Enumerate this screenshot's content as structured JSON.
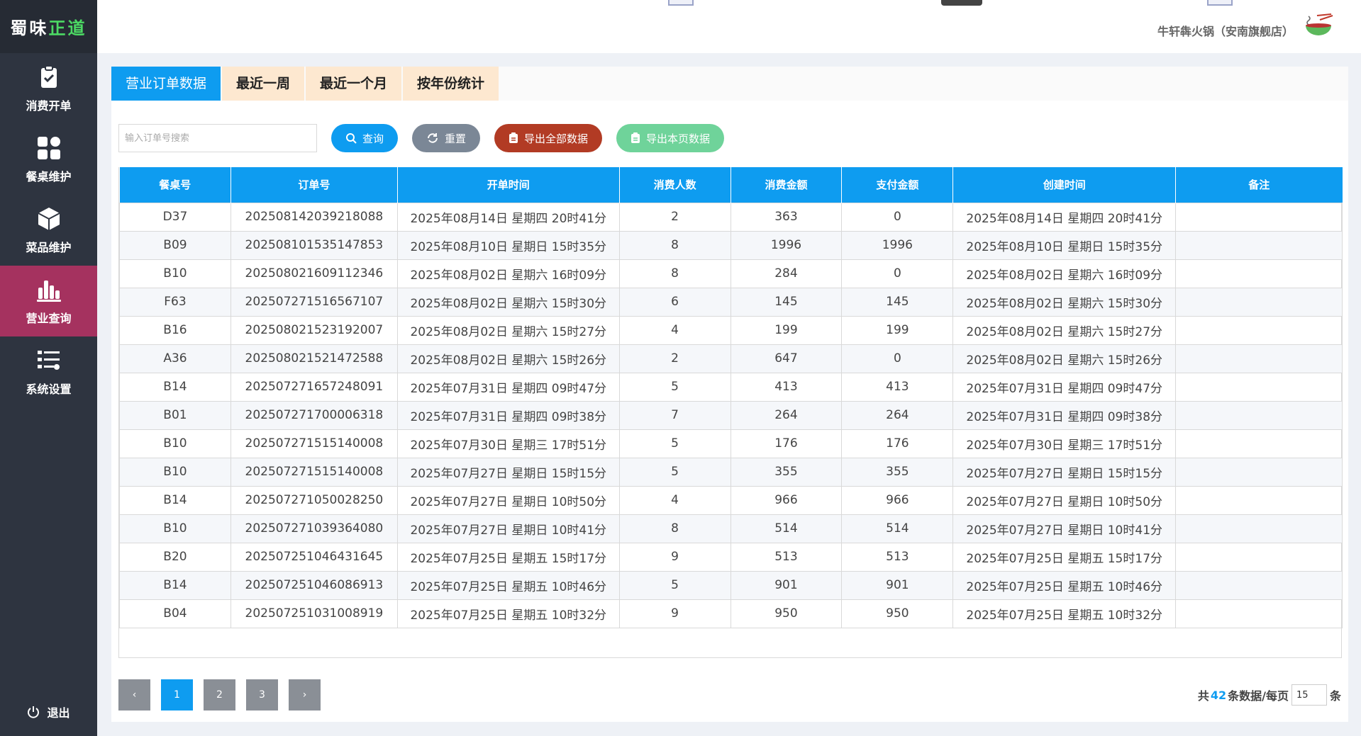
{
  "brand": {
    "part1": "蜀味",
    "part2": "正道"
  },
  "sidebar": {
    "items": [
      {
        "label": "消费开单",
        "icon": "clipboard-check-icon"
      },
      {
        "label": "餐桌维护",
        "icon": "grid-apps-icon"
      },
      {
        "label": "菜品维护",
        "icon": "box-icon"
      },
      {
        "label": "营业查询",
        "icon": "bar-chart-icon",
        "active": true
      },
      {
        "label": "系统设置",
        "icon": "settings-list-icon"
      }
    ],
    "logout_label": "退出"
  },
  "header": {
    "store_name": "牛轩犇火锅（安南旗舰店）"
  },
  "tabs": [
    "营业订单数据",
    "最近一周",
    "最近一个月",
    "按年份统计"
  ],
  "toolbar": {
    "search_placeholder": "输入订单号搜索",
    "query_label": "查询",
    "reset_label": "重置",
    "export_all_label": "导出全部数据",
    "export_page_label": "导出本页数据"
  },
  "table": {
    "headers": [
      "餐桌号",
      "订单号",
      "开单时间",
      "消费人数",
      "消费金额",
      "支付金额",
      "创建时间",
      "备注"
    ],
    "rows": [
      [
        "D37",
        "202508142039218088",
        "2025年08月14日 星期四 20时41分",
        "2",
        "363",
        "0",
        "2025年08月14日 星期四 20时41分",
        ""
      ],
      [
        "B09",
        "202508101535147853",
        "2025年08月10日 星期日 15时35分",
        "8",
        "1996",
        "1996",
        "2025年08月10日 星期日 15时35分",
        ""
      ],
      [
        "B10",
        "202508021609112346",
        "2025年08月02日 星期六 16时09分",
        "8",
        "284",
        "0",
        "2025年08月02日 星期六 16时09分",
        ""
      ],
      [
        "F63",
        "202507271516567107",
        "2025年08月02日 星期六 15时30分",
        "6",
        "145",
        "145",
        "2025年08月02日 星期六 15时30分",
        ""
      ],
      [
        "B16",
        "202508021523192007",
        "2025年08月02日 星期六 15时27分",
        "4",
        "199",
        "199",
        "2025年08月02日 星期六 15时27分",
        ""
      ],
      [
        "A36",
        "202508021521472588",
        "2025年08月02日 星期六 15时26分",
        "2",
        "647",
        "0",
        "2025年08月02日 星期六 15时26分",
        ""
      ],
      [
        "B14",
        "202507271657248091",
        "2025年07月31日 星期四 09时47分",
        "5",
        "413",
        "413",
        "2025年07月31日 星期四 09时47分",
        ""
      ],
      [
        "B01",
        "202507271700006318",
        "2025年07月31日 星期四 09时38分",
        "7",
        "264",
        "264",
        "2025年07月31日 星期四 09时38分",
        ""
      ],
      [
        "B10",
        "202507271515140008",
        "2025年07月30日 星期三 17时51分",
        "5",
        "176",
        "176",
        "2025年07月30日 星期三 17时51分",
        ""
      ],
      [
        "B10",
        "202507271515140008",
        "2025年07月27日 星期日 15时15分",
        "5",
        "355",
        "355",
        "2025年07月27日 星期日 15时15分",
        ""
      ],
      [
        "B14",
        "202507271050028250",
        "2025年07月27日 星期日 10时50分",
        "4",
        "966",
        "966",
        "2025年07月27日 星期日 10时50分",
        ""
      ],
      [
        "B10",
        "202507271039364080",
        "2025年07月27日 星期日 10时41分",
        "8",
        "514",
        "514",
        "2025年07月27日 星期日 10时41分",
        ""
      ],
      [
        "B20",
        "202507251046431645",
        "2025年07月25日 星期五 15时17分",
        "9",
        "513",
        "513",
        "2025年07月25日 星期五 15时17分",
        ""
      ],
      [
        "B14",
        "202507251046086913",
        "2025年07月25日 星期五 10时46分",
        "5",
        "901",
        "901",
        "2025年07月25日 星期五 10时46分",
        ""
      ],
      [
        "B04",
        "202507251031008919",
        "2025年07月25日 星期五 10时32分",
        "9",
        "950",
        "950",
        "2025年07月25日 星期五 10时32分",
        ""
      ]
    ]
  },
  "pagination": {
    "prev": "‹",
    "next": "›",
    "pages": [
      "1",
      "2",
      "3"
    ],
    "current": "1",
    "total_prefix": "共",
    "total_count": "42",
    "total_suffix": "条数据/每页",
    "page_size": "15",
    "unit": "条"
  },
  "colors": {
    "primary": "#0e9cf0",
    "sidebar_bg": "#2e3440",
    "active_nav": "#a5325f",
    "tab_inactive": "#fde8d0",
    "export_all": "#b23b24",
    "export_page": "#6fd39a",
    "reset": "#7b8796"
  }
}
